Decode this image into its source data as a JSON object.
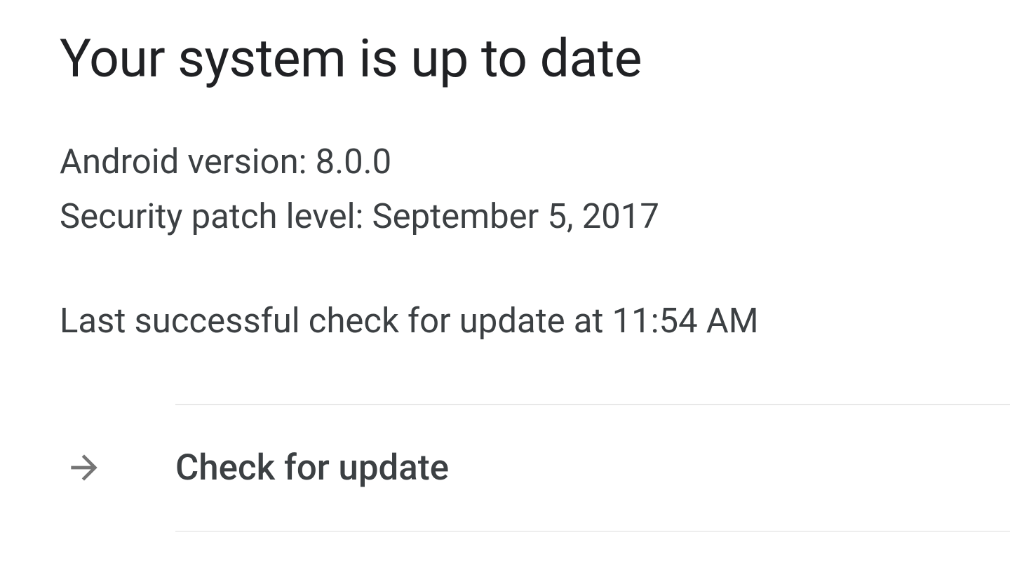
{
  "title": "Your system is up to date",
  "android_version_line": "Android version: 8.0.0",
  "security_patch_line": "Security patch level: September 5, 2017",
  "last_check_line": "Last successful check for update at 11:54 AM",
  "check_update_label": "Check for update"
}
